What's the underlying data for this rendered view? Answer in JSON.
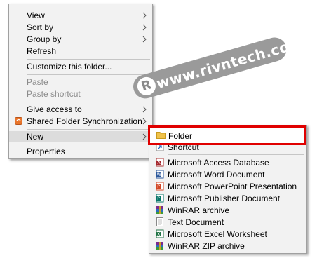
{
  "context_menu": {
    "items": [
      {
        "label": "View",
        "has_submenu": true
      },
      {
        "label": "Sort by",
        "has_submenu": true
      },
      {
        "label": "Group by",
        "has_submenu": true
      },
      {
        "label": "Refresh"
      },
      {
        "label": "Customize this folder..."
      },
      {
        "label": "Paste",
        "disabled": true
      },
      {
        "label": "Paste shortcut",
        "disabled": true
      },
      {
        "label": "Give access to",
        "has_submenu": true
      },
      {
        "label": "Shared Folder Synchronization",
        "has_submenu": true,
        "icon": "sync-icon"
      },
      {
        "label": "New",
        "has_submenu": true,
        "active": true
      },
      {
        "label": "Properties"
      }
    ]
  },
  "new_submenu": {
    "folder": {
      "label": "Folder",
      "icon": "folder-icon"
    },
    "shortcut": {
      "label": "Shortcut",
      "icon": "shortcut-icon"
    },
    "items": [
      {
        "label": "Microsoft Access Database",
        "icon": "access-icon"
      },
      {
        "label": "Microsoft Word Document",
        "icon": "word-icon"
      },
      {
        "label": "Microsoft PowerPoint Presentation",
        "icon": "powerpoint-icon"
      },
      {
        "label": "Microsoft Publisher Document",
        "icon": "publisher-icon"
      },
      {
        "label": "WinRAR archive",
        "icon": "winrar-icon"
      },
      {
        "label": "Text Document",
        "icon": "text-document-icon"
      },
      {
        "label": "Microsoft Excel Worksheet",
        "icon": "excel-icon"
      },
      {
        "label": "WinRAR ZIP archive",
        "icon": "winrar-zip-icon"
      }
    ]
  },
  "watermark": {
    "text": "www.rivntech.com",
    "logo": "R"
  },
  "colors": {
    "highlight_border": "#e00000",
    "menu_bg": "#f2f2f2"
  }
}
